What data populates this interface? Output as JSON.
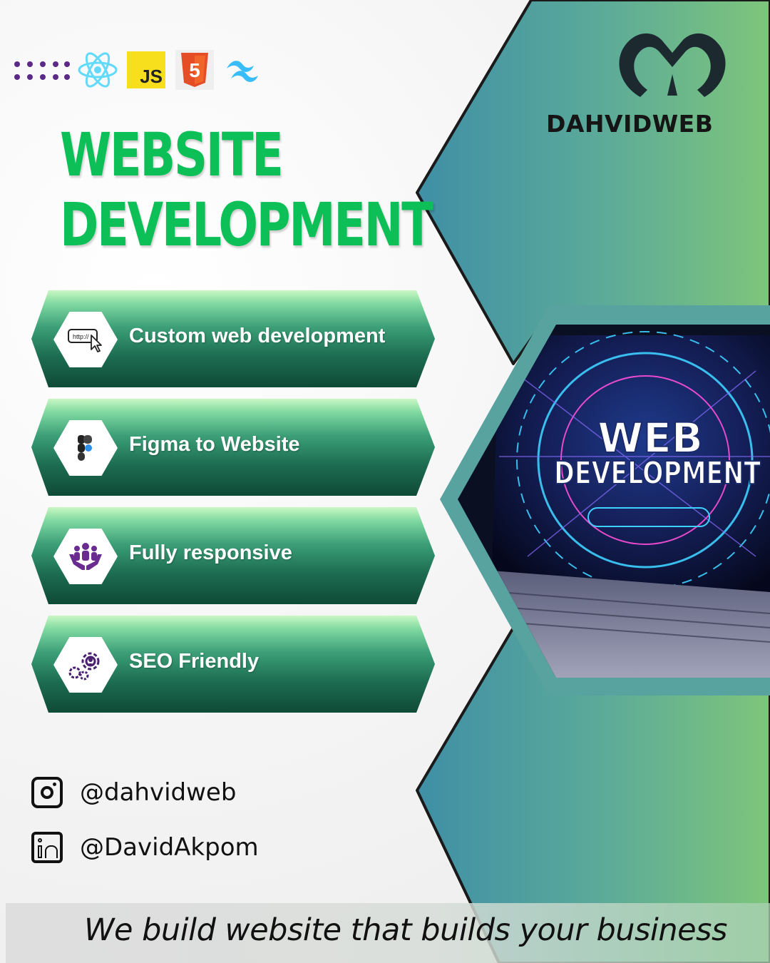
{
  "tech_stack": {
    "icons": [
      "dot-grid-icon",
      "react-icon",
      "javascript-icon",
      "html5-icon",
      "tailwind-icon"
    ],
    "js_label": "JS",
    "html_label": "5"
  },
  "headline": {
    "line1": "WEBSITE",
    "line2": "DEVELOPMENT",
    "color": "#0dbf57"
  },
  "brand": {
    "name": "DAHVIDWEB",
    "logo_icon": "dahvidweb-logo-icon"
  },
  "features": [
    {
      "label": "Custom web development",
      "icon": "browser-url-cursor-icon",
      "url_text": "http://"
    },
    {
      "label": "Figma to Website",
      "icon": "figma-icon"
    },
    {
      "label": "Fully responsive",
      "icon": "team-hands-icon"
    },
    {
      "label": "SEO Friendly",
      "icon": "gears-user-icon"
    }
  ],
  "hero_image": {
    "line1": "WEB",
    "line2": "DEVELOPMENT"
  },
  "social": [
    {
      "network": "instagram",
      "icon": "instagram-icon",
      "handle": "@dahvidweb"
    },
    {
      "network": "linkedin",
      "icon": "linkedin-icon",
      "handle": "@DavidAkpom"
    }
  ],
  "tagline": "We build website that builds your business",
  "colors": {
    "teal": "#4b9aa8",
    "green": "#7fc47a",
    "accent_green": "#0dbf57",
    "purple": "#5b2a86"
  }
}
